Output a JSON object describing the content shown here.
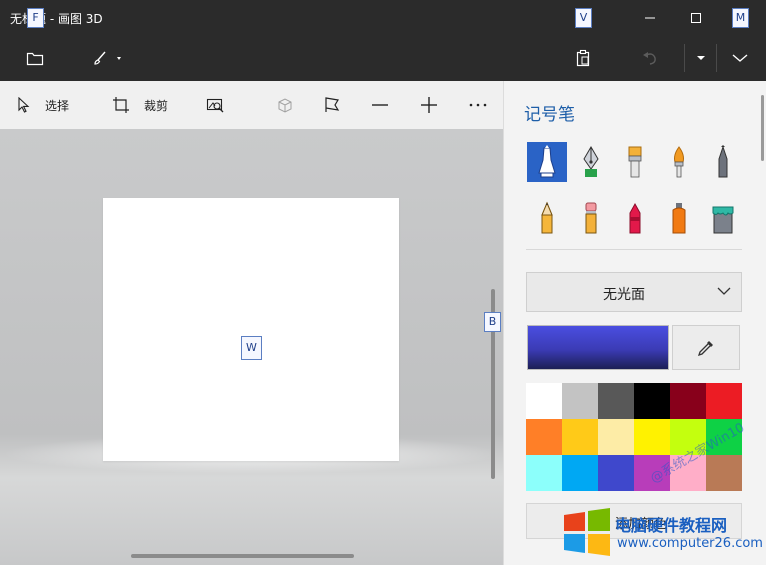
{
  "window": {
    "title": "无标题 - 画图 3D",
    "keytips": {
      "file": "F",
      "view": "V",
      "menu": "M",
      "canvas": "W",
      "brush_panel": "B"
    }
  },
  "toolbar": {
    "select_label": "选择",
    "crop_label": "裁剪"
  },
  "panel": {
    "title": "记号笔",
    "brushes": [
      "marker-icon",
      "calligraphy-pen-icon",
      "oil-brush-icon",
      "watercolor-icon",
      "pixel-pen-icon",
      "pencil-icon",
      "eraser-icon",
      "crayon-icon",
      "spray-can-icon",
      "fill-bucket-icon"
    ],
    "finish": {
      "value": "无光面"
    },
    "current_color": "#3b3bb5",
    "palette": [
      "#ffffff",
      "#c3c3c3",
      "#585858",
      "#000000",
      "#88001b",
      "#ec1c24",
      "#ff7f27",
      "#ffca18",
      "#fdeca6",
      "#fff200",
      "#c4ff0e",
      "#0ed145",
      "#8cfffb",
      "#00a8f3",
      "#3f48cc",
      "#b83dba",
      "#ffaec8",
      "#b97a56"
    ],
    "add_color_label": "添加颜色"
  },
  "watermark": {
    "site_name": "电脑硬件教程网",
    "url": "www.computer26.com",
    "diag_text": "@系统之家Win10"
  }
}
